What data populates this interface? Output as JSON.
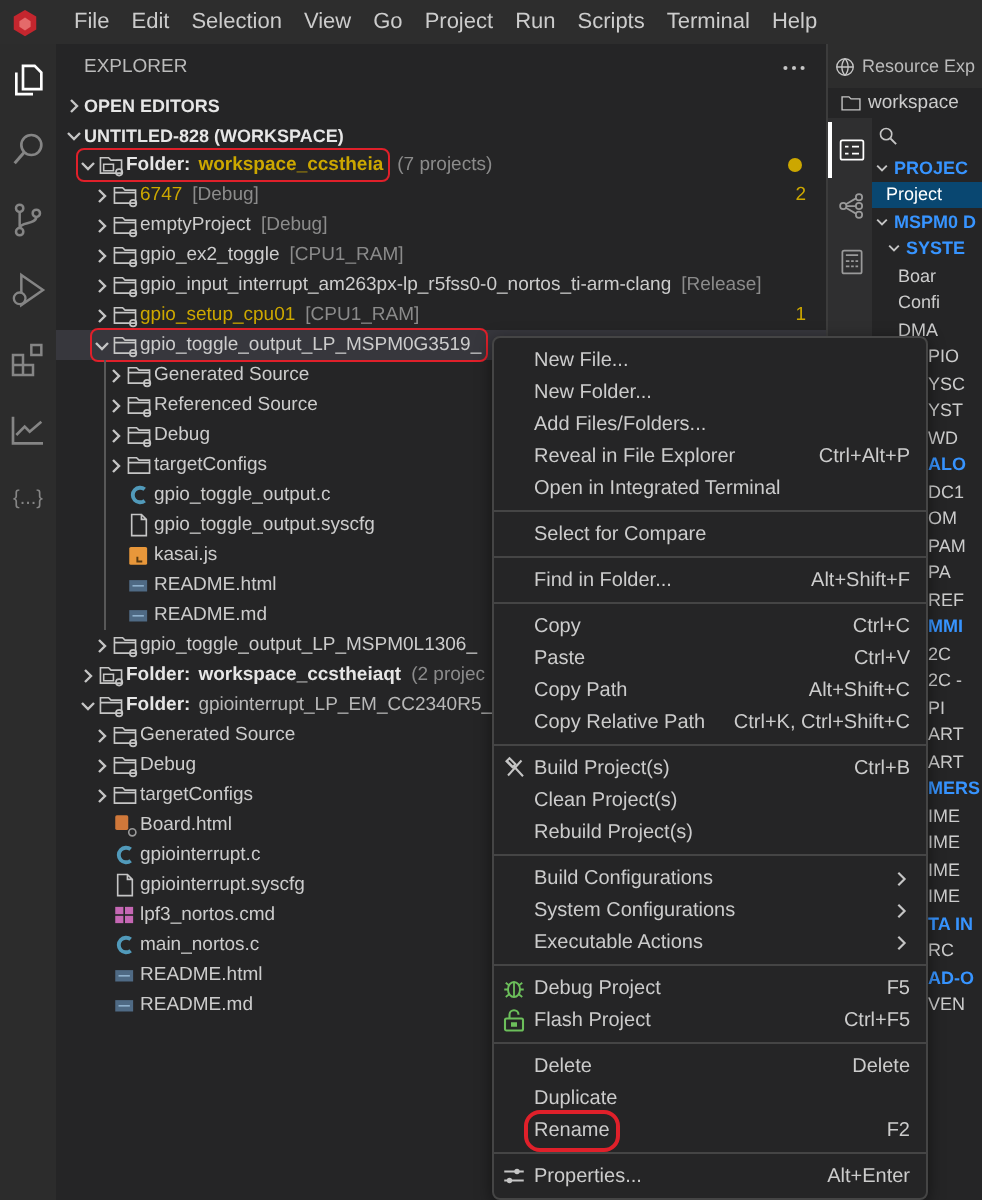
{
  "menu_bar": {
    "items": [
      "File",
      "Edit",
      "Selection",
      "View",
      "Go",
      "Project",
      "Run",
      "Scripts",
      "Terminal",
      "Help"
    ]
  },
  "activity_bar": [
    {
      "selected": true
    },
    {
      "selected": false
    },
    {
      "selected": false
    },
    {
      "selected": false
    },
    {
      "selected": false
    },
    {
      "selected": false
    },
    {
      "glyph": "{...}",
      "selected": false
    }
  ],
  "explorer": {
    "title": "EXPLORER",
    "sections": [
      {
        "kind": "section",
        "label": "OPEN EDITORS",
        "expanded": false
      },
      {
        "kind": "section",
        "label": "UNTITLED-828 (WORKSPACE)",
        "expanded": true,
        "children": [
          {
            "kind": "folder",
            "prefix": "Folder:",
            "label": "workspace_ccstheia",
            "description": "(7 projects)",
            "expanded": true,
            "modified": true,
            "outlined": true,
            "children": [
              {
                "kind": "project",
                "label": "6747",
                "description": "[Debug]",
                "expanded": false,
                "modified": true,
                "badge": "2"
              },
              {
                "kind": "project",
                "label": "emptyProject",
                "description": "[Debug]",
                "expanded": false,
                "modified": false
              },
              {
                "kind": "project",
                "label": "gpio_ex2_toggle",
                "description": "[CPU1_RAM]",
                "expanded": false,
                "modified": false
              },
              {
                "kind": "project",
                "label": "gpio_input_interrupt_am263px-lp_r5fss0-0_nortos_ti-arm-clang",
                "description": "[Release]",
                "expanded": false,
                "modified": false
              },
              {
                "kind": "project",
                "label": "gpio_setup_cpu01",
                "description": "[CPU1_RAM]",
                "expanded": false,
                "modified": true,
                "badge": "1"
              },
              {
                "kind": "project",
                "label": "gpio_toggle_output_LP_MSPM0G3519_",
                "expanded": true,
                "modified": false,
                "selected": true,
                "outlined": true,
                "children": [
                  {
                    "kind": "dir",
                    "label": "Generated Source",
                    "expanded": false
                  },
                  {
                    "kind": "dir",
                    "label": "Referenced Source",
                    "expanded": false
                  },
                  {
                    "kind": "dir",
                    "label": "Debug",
                    "expanded": false
                  },
                  {
                    "kind": "config-dir",
                    "label": "targetConfigs",
                    "expanded": false
                  },
                  {
                    "kind": "c-file",
                    "label": "gpio_toggle_output.c"
                  },
                  {
                    "kind": "text-file",
                    "label": "gpio_toggle_output.syscfg"
                  },
                  {
                    "kind": "js-file",
                    "label": "kasai.js"
                  },
                  {
                    "kind": "doc-file",
                    "label": "README.html"
                  },
                  {
                    "kind": "doc-file",
                    "label": "README.md"
                  }
                ]
              },
              {
                "kind": "project",
                "label": "gpio_toggle_output_LP_MSPM0L1306_",
                "expanded": false,
                "modified": false
              }
            ]
          },
          {
            "kind": "folder",
            "prefix": "Folder:",
            "label": "workspace_ccstheiaqt",
            "description": "(2 projec",
            "expanded": false,
            "modified": false
          },
          {
            "kind": "project-folder",
            "prefix": "Folder:",
            "label": "gpiointerrupt_LP_EM_CC2340R5_",
            "expanded": true,
            "modified": false,
            "children": [
              {
                "kind": "dir",
                "label": "Generated Source",
                "expanded": false
              },
              {
                "kind": "dir",
                "label": "Debug",
                "expanded": false
              },
              {
                "kind": "config-dir",
                "label": "targetConfigs",
                "expanded": false
              },
              {
                "kind": "board-file",
                "label": "Board.html"
              },
              {
                "kind": "c-file",
                "label": "gpiointerrupt.c"
              },
              {
                "kind": "text-file",
                "label": "gpiointerrupt.syscfg"
              },
              {
                "kind": "cmd-file",
                "label": "lpf3_nortos.cmd"
              },
              {
                "kind": "c-file",
                "label": "main_nortos.c"
              },
              {
                "kind": "doc-file",
                "label": "README.html"
              },
              {
                "kind": "doc-file",
                "label": "README.md"
              }
            ]
          }
        ]
      }
    ]
  },
  "resource_explorer": {
    "tab": "Resource Exp",
    "breadcrumb": "workspace",
    "side_icons": [
      {
        "selected": true
      },
      {
        "selected": false
      },
      {
        "selected": false
      }
    ],
    "tree": [
      {
        "kind": "header",
        "label": "PROJEC",
        "expanded": true,
        "children": [
          {
            "kind": "item",
            "label": "Project",
            "selected": true
          }
        ]
      },
      {
        "kind": "header",
        "label": "MSPM0 D",
        "expanded": true,
        "children": [
          {
            "kind": "header",
            "label": "SYSTE",
            "expanded": true,
            "children": [
              {
                "kind": "item",
                "label": "Boar"
              },
              {
                "kind": "item",
                "label": "Confi"
              },
              {
                "kind": "item",
                "label": "DMA"
              },
              {
                "kind": "item",
                "label": "PIO",
                "cut": true
              },
              {
                "kind": "item",
                "label": "YSC",
                "cut": true
              },
              {
                "kind": "item",
                "label": "YST",
                "cut": true
              },
              {
                "kind": "item",
                "label": "WD",
                "cut": true
              }
            ]
          },
          {
            "kind": "header",
            "label": "ALO",
            "cut": true,
            "children": [
              {
                "kind": "item",
                "label": "DC1",
                "cut": true
              },
              {
                "kind": "item",
                "label": "OM",
                "cut": true
              },
              {
                "kind": "item",
                "label": "PAM",
                "cut": true
              },
              {
                "kind": "item",
                "label": "PA",
                "cut": true
              },
              {
                "kind": "item",
                "label": "REF",
                "cut": true
              }
            ]
          },
          {
            "kind": "header",
            "label": "MMI",
            "cut": true,
            "children": [
              {
                "kind": "item",
                "label": "2C",
                "cut": true
              },
              {
                "kind": "item",
                "label": "2C -",
                "cut": true
              },
              {
                "kind": "item",
                "label": "PI",
                "cut": true
              },
              {
                "kind": "item",
                "label": "ART",
                "cut": true
              },
              {
                "kind": "item",
                "label": "ART",
                "cut": true
              }
            ]
          },
          {
            "kind": "header",
            "label": "MERS",
            "cut": true,
            "children": [
              {
                "kind": "item",
                "label": "IME",
                "cut": true
              },
              {
                "kind": "item",
                "label": "IME",
                "cut": true
              },
              {
                "kind": "item",
                "label": "IME",
                "cut": true
              },
              {
                "kind": "item",
                "label": "IME",
                "cut": true
              }
            ]
          },
          {
            "kind": "header",
            "label": "TA IN",
            "cut": true,
            "children": [
              {
                "kind": "item",
                "label": "RC",
                "cut": true
              }
            ]
          },
          {
            "kind": "header",
            "label": "AD-O",
            "cut": true,
            "children": [
              {
                "kind": "item",
                "label": "VEN",
                "cut": true
              }
            ]
          }
        ]
      }
    ]
  },
  "context_menu": {
    "groups": [
      [
        {
          "label": "New File..."
        },
        {
          "label": "New Folder..."
        },
        {
          "label": "Add Files/Folders..."
        },
        {
          "label": "Reveal in File Explorer",
          "shortcut": "Ctrl+Alt+P"
        },
        {
          "label": "Open in Integrated Terminal"
        }
      ],
      [
        {
          "label": "Select for Compare"
        }
      ],
      [
        {
          "label": "Find in Folder...",
          "shortcut": "Alt+Shift+F"
        }
      ],
      [
        {
          "label": "Copy",
          "shortcut": "Ctrl+C"
        },
        {
          "label": "Paste",
          "shortcut": "Ctrl+V"
        },
        {
          "label": "Copy Path",
          "shortcut": "Alt+Shift+C"
        },
        {
          "label": "Copy Relative Path",
          "shortcut": "Ctrl+K, Ctrl+Shift+C"
        }
      ],
      [
        {
          "kind": "build",
          "label": "Build Project(s)",
          "shortcut": "Ctrl+B"
        },
        {
          "label": "Clean Project(s)"
        },
        {
          "label": "Rebuild Project(s)"
        }
      ],
      [
        {
          "label": "Build Configurations",
          "submenu": true
        },
        {
          "label": "System Configurations",
          "submenu": true
        },
        {
          "label": "Executable Actions",
          "submenu": true
        }
      ],
      [
        {
          "kind": "debug",
          "label": "Debug Project",
          "shortcut": "F5"
        },
        {
          "kind": "flash",
          "label": "Flash Project",
          "shortcut": "Ctrl+F5"
        }
      ],
      [
        {
          "label": "Delete",
          "shortcut": "Delete"
        },
        {
          "label": "Duplicate"
        },
        {
          "label": "Rename",
          "shortcut": "F2",
          "outlined": true
        }
      ],
      [
        {
          "kind": "properties",
          "label": "Properties...",
          "shortcut": "Alt+Enter"
        }
      ]
    ]
  }
}
